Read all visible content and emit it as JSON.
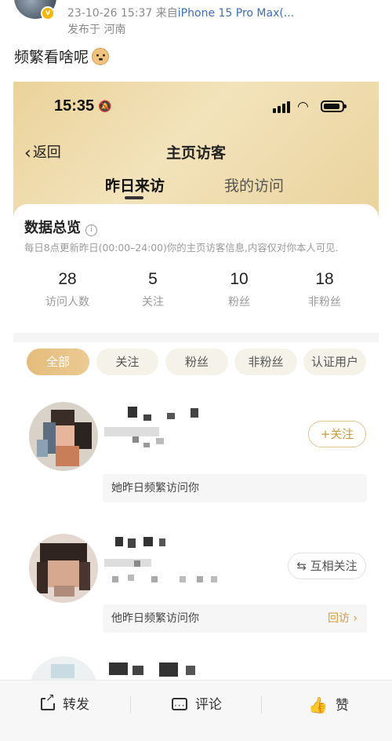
{
  "post": {
    "timestamp": "23-10-26 15:37",
    "source_prefix": "来自",
    "device": "iPhone 15 Pro Max(...",
    "location": "发布于 河南",
    "text": "频繁看啥呢"
  },
  "screenshot": {
    "status_time": "15:35",
    "nav": {
      "back_label": "返回",
      "title": "主页访客"
    },
    "tabs": [
      {
        "label": "昨日来访",
        "active": true
      },
      {
        "label": "我的访问",
        "active": false
      }
    ],
    "overview": {
      "title": "数据总览",
      "note": "每日8点更新昨日(00:00–24:00)你的主页访客信息,内容仅对你本人可见.",
      "stats": [
        {
          "value": "28",
          "label": "访问人数"
        },
        {
          "value": "5",
          "label": "关注"
        },
        {
          "value": "10",
          "label": "粉丝"
        },
        {
          "value": "18",
          "label": "非粉丝"
        }
      ]
    },
    "filters": [
      "全部",
      "关注",
      "粉丝",
      "非粉丝",
      "认证用户"
    ],
    "visitors": [
      {
        "action": "+关注",
        "message": "她昨日频繁访问你",
        "revisit": ""
      },
      {
        "action": "⇆ 互相关注",
        "message": "他昨日频繁访问你",
        "revisit": "回访 ›"
      }
    ]
  },
  "actions": {
    "repost": "转发",
    "comment": "评论",
    "like": "赞"
  },
  "colors": {
    "accent_gold": "#c89b3e",
    "like_red": "#f25c3c",
    "link_blue": "#3d6fb6"
  }
}
